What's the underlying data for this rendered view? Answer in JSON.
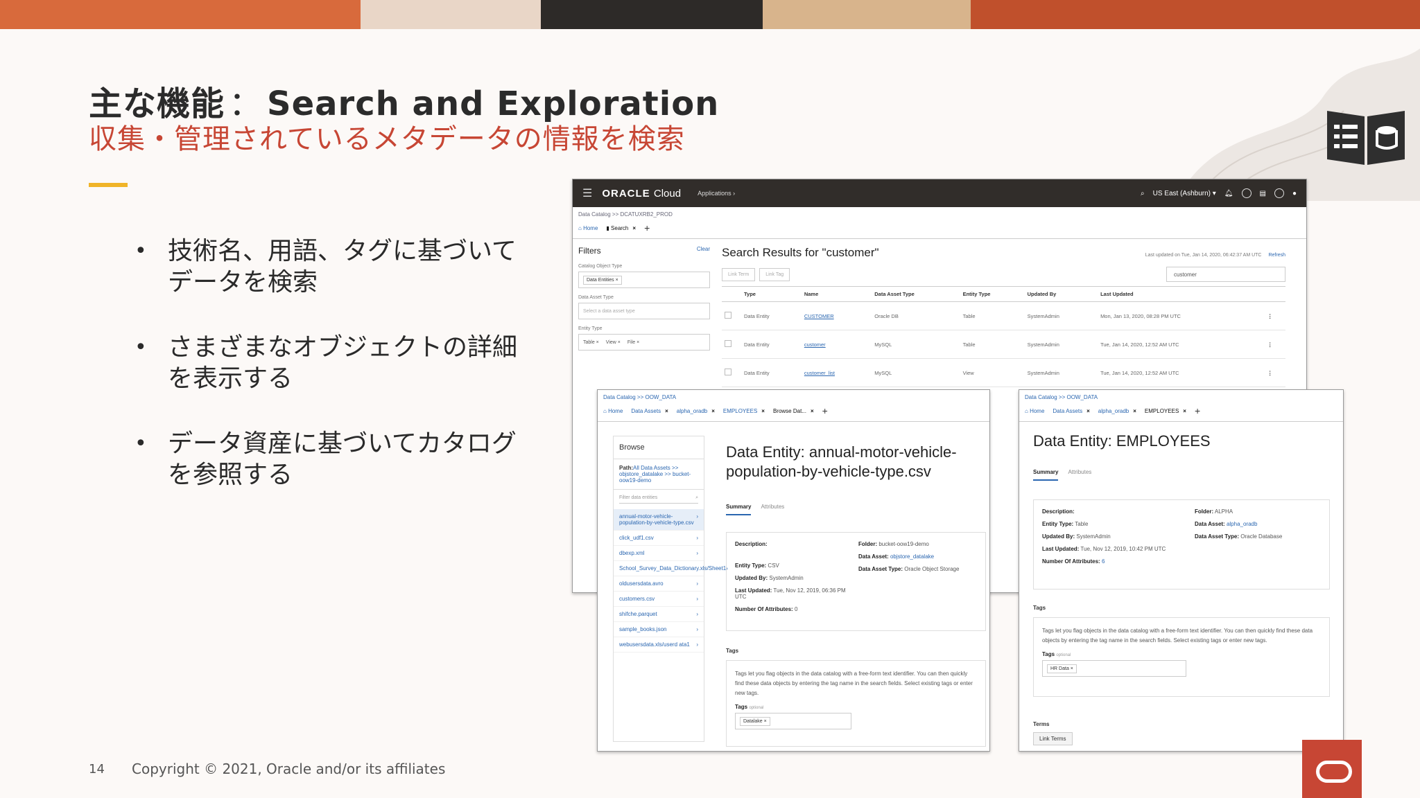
{
  "slide": {
    "title_prefix": "主な機能",
    "title_sep": "：",
    "title_main": "Search and Exploration",
    "subtitle": "収集・管理されているメタデータの情報を検索",
    "bullets": [
      {
        "line1": "技術名、用語、タグに基づいて",
        "line2": "データを検索"
      },
      {
        "line1": "さまざまなオブジェクトの詳細",
        "line2": "を表示する"
      },
      {
        "line1": "データ資産に基づいてカタログ",
        "line2": "を参照する"
      }
    ],
    "bullet_glyph": "•",
    "page_number": "14",
    "copyright": "Copyright © 2021, Oracle and/or its affiliates",
    "colors": {
      "accent_red": "#c74634",
      "accent_yellow": "#f0b429",
      "dark_bar": "#312d2a",
      "link": "#2a66b0"
    }
  },
  "app": {
    "logo": "ORACLE",
    "logo_suffix": "Cloud",
    "apps_menu": "Applications ›",
    "region": "US East (Ashburn) ▾",
    "icons": [
      "search-icon",
      "bell-icon",
      "help-icon",
      "chat-icon",
      "globe-icon",
      "user-icon"
    ]
  },
  "search_screen": {
    "breadcrumb": "Data Catalog >> DCATUXRB2_PROD",
    "tabs": [
      {
        "label": "Home"
      },
      {
        "label": "Search"
      }
    ],
    "filters_title": "Filters",
    "filters_clear": "Clear",
    "filter_groups": [
      {
        "label": "Catalog Object Type",
        "chips": [
          "Data Entities ×"
        ]
      },
      {
        "label": "Data Asset Type",
        "placeholder": "Select a data asset type"
      },
      {
        "label": "Entity Type",
        "chips": [
          "Table ×",
          "View ×",
          "File ×"
        ]
      }
    ],
    "results_title": "Search Results for \"customer\"",
    "last_updated": "Last updated on Tue, Jan 14, 2020, 06:42:37 AM UTC",
    "refresh": "Refresh",
    "buttons": [
      "Link Term",
      "Link Tag"
    ],
    "search_value": "customer",
    "columns": [
      "Type",
      "Name",
      "Data Asset Type",
      "Entity Type",
      "Updated By",
      "Last Updated"
    ],
    "rows": [
      [
        "Data Entity",
        "CUSTOMER",
        "Oracle DB",
        "Table",
        "SystemAdmin",
        "Mon, Jan 13, 2020, 08:28 PM UTC"
      ],
      [
        "Data Entity",
        "customer",
        "MySQL",
        "Table",
        "SystemAdmin",
        "Tue, Jan 14, 2020, 12:52 AM UTC"
      ],
      [
        "Data Entity",
        "customer_list",
        "MySQL",
        "View",
        "SystemAdmin",
        "Tue, Jan 14, 2020, 12:52 AM UTC"
      ]
    ]
  },
  "entity_screen_1": {
    "breadcrumb": "Data Catalog >> OOW_DATA",
    "tabs": [
      "Home",
      "Data Assets",
      "alpha_oradb",
      "EMPLOYEES",
      "Browse Dat..."
    ],
    "browse_title": "Browse",
    "path_label": "Path:",
    "path_value": "All Data Assets >> objstore_datalake >> bucket-oow19-demo",
    "filter_placeholder": "Filter data entities",
    "items": [
      "annual-motor-vehicle-population-by-vehicle-type.csv",
      "click_udf1.csv",
      "dbexp.xml",
      "School_Survey_Data_Dictionary.xls/Sheet1",
      "oldusersdata.avro",
      "customers.csv",
      "shifche.parquet",
      "sample_books.json",
      "webusersdata.xls/userd ata1"
    ],
    "title_label": "Data Entity:",
    "title_value": "annual-motor-vehicle-population-by-vehicle-type.csv",
    "subtabs": [
      "Summary",
      "Attributes"
    ],
    "description_label": "Description:",
    "entity_type_label": "Entity Type:",
    "entity_type": "CSV",
    "updated_by_label": "Updated By:",
    "updated_by": "SystemAdmin",
    "last_updated_label": "Last Updated:",
    "last_updated": "Tue, Nov 12, 2019, 06:36 PM UTC",
    "num_attr_label": "Number Of Attributes:",
    "num_attr": "0",
    "folder_label": "Folder:",
    "folder": "bucket-oow19-demo",
    "data_asset_label": "Data Asset:",
    "data_asset": "objstore_datalake",
    "data_asset_type_label": "Data Asset Type:",
    "data_asset_type": "Oracle Object Storage",
    "tags_title": "Tags",
    "tags_desc": "Tags let you flag objects in the data catalog with a free-form text identifier. You can then quickly find these data objects by entering the tag name in the search fields. Select existing tags or enter new tags.",
    "tags_label": "Tags",
    "tags_hint": "optional",
    "tag_chip": "Datalake ×"
  },
  "entity_screen_2": {
    "breadcrumb": "Data Catalog >> OOW_DATA",
    "tabs": [
      "Home",
      "Data Assets",
      "alpha_oradb",
      "EMPLOYEES"
    ],
    "title_label": "Data Entity:",
    "title_value": "EMPLOYEES",
    "subtabs": [
      "Summary",
      "Attributes"
    ],
    "description_label": "Description:",
    "entity_type_label": "Entity Type:",
    "entity_type": "Table",
    "updated_by_label": "Updated By:",
    "updated_by": "SystemAdmin",
    "last_updated_label": "Last Updated:",
    "last_updated": "Tue, Nov 12, 2019, 10:42 PM UTC",
    "num_attr_label": "Number Of Attributes:",
    "num_attr": "6",
    "folder_label": "Folder:",
    "folder": "ALPHA",
    "data_asset_label": "Data Asset:",
    "data_asset": "alpha_oradb",
    "data_asset_type_label": "Data Asset Type:",
    "data_asset_type": "Oracle Database",
    "tags_title": "Tags",
    "tags_desc": "Tags let you flag objects in the data catalog with a free-form text identifier. You can then quickly find these data objects by entering the tag name in the search fields. Select existing tags or enter new tags.",
    "tags_label": "Tags",
    "tags_hint": "optional",
    "tag_chip": "HR Data ×",
    "terms_title": "Terms",
    "link_terms": "Link Terms"
  }
}
